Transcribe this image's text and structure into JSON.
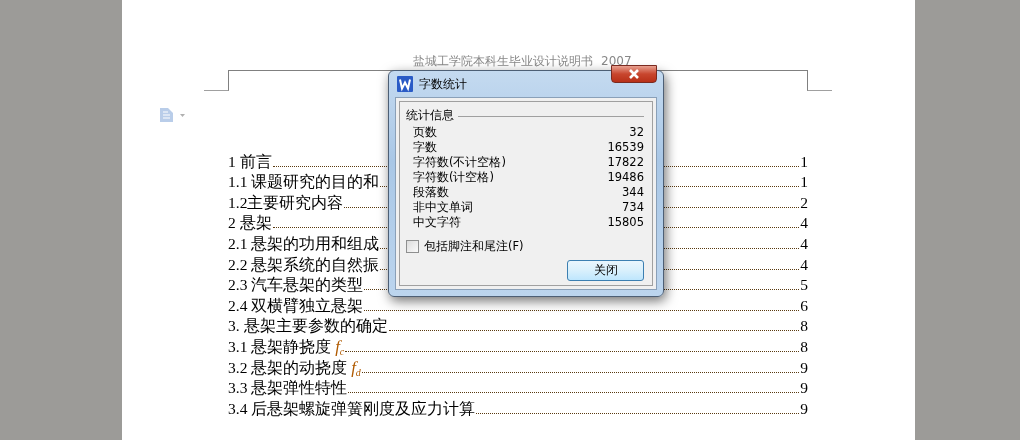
{
  "document": {
    "header": "盐城工学院本科生毕业设计说明书  2007",
    "toc": [
      {
        "title": "1 前言",
        "page": "1"
      },
      {
        "title": "1.1 课题研究的目的和",
        "page": "1"
      },
      {
        "title": "1.2主要研究内容",
        "page": "2"
      },
      {
        "title": "2 悬架",
        "page": "4"
      },
      {
        "title": "2.1 悬架的功用和组成",
        "page": "4"
      },
      {
        "title": "2.2 悬架系统的自然振",
        "page": "4"
      },
      {
        "title": "2.3 汽车悬架的类型",
        "page": "5"
      },
      {
        "title": "2.4 双横臂独立悬架",
        "page": "6"
      },
      {
        "title": "3. 悬架主要参数的确定",
        "page": "8"
      },
      {
        "title": "3.1 悬架静挠度 *f*$_{c}$",
        "page": "8"
      },
      {
        "title": "3.2 悬架的动挠度 *f*$_{d}$",
        "page": "9"
      },
      {
        "title": "3.3 悬架弹性特性",
        "page": "9"
      },
      {
        "title": "3.4 后悬架螺旋弹簧刚度及应力计算",
        "page": "9"
      }
    ]
  },
  "dialog": {
    "title": "字数统计",
    "group": "统计信息",
    "stats": [
      {
        "label": "页数",
        "value": "32"
      },
      {
        "label": "字数",
        "value": "16539"
      },
      {
        "label": "字符数(不计空格)",
        "value": "17822"
      },
      {
        "label": "字符数(计空格)",
        "value": "19486"
      },
      {
        "label": "段落数",
        "value": "344"
      },
      {
        "label": "非中文单词",
        "value": "734"
      },
      {
        "label": "中文字符",
        "value": "15805"
      }
    ],
    "checkbox": {
      "label": "包括脚注和尾注(F)",
      "checked": false
    },
    "buttons": [
      "关闭"
    ]
  }
}
